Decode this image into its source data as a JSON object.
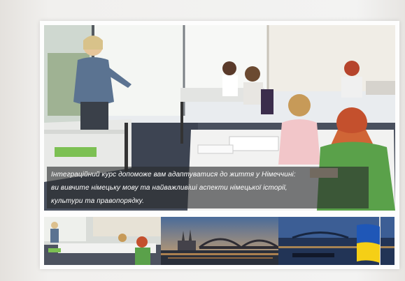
{
  "main_image": {
    "alt_icon": "classroom-photo",
    "caption_lines": [
      "Інтеграційний курс допоможе вам адаптуватися до життя у Німеччині:",
      "ви вивчите німецьку мову та найважливіші аспекти німецької історії,",
      "культури та правопорядку."
    ]
  },
  "thumbnails": [
    {
      "icon": "classroom-photo"
    },
    {
      "icon": "cologne-cathedral-photo"
    },
    {
      "icon": "ukraine-flag-photo"
    }
  ],
  "colors": {
    "caption_overlay": "#2a2c2e",
    "flag_blue": "#1f57b7",
    "flag_yellow": "#f5cf16"
  }
}
